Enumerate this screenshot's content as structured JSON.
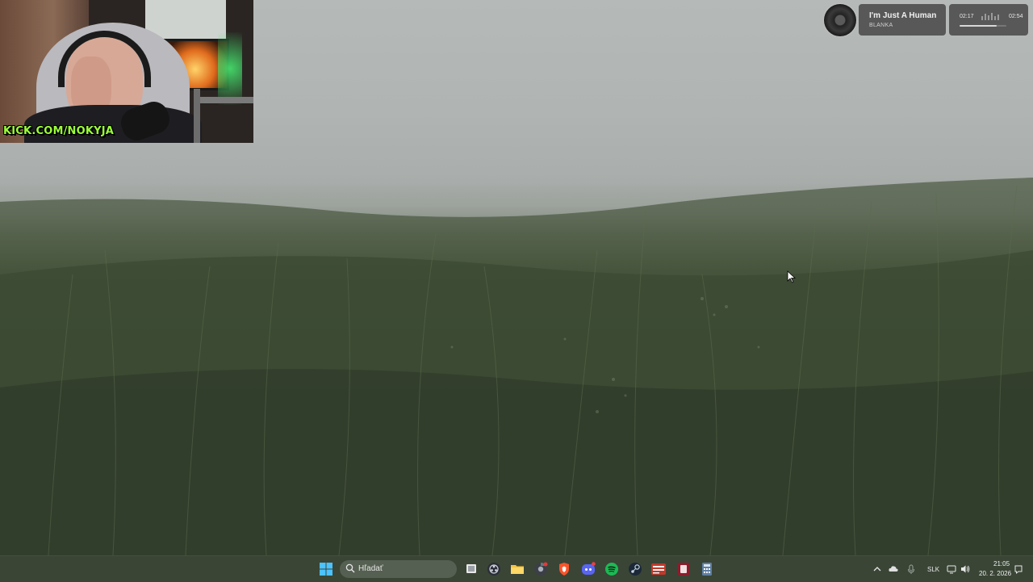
{
  "webcam": {
    "handle_text": "KICK.COM/NOKYJA"
  },
  "media_player": {
    "icon": "vinyl-disc-icon",
    "track_title": "I'm Just A Human",
    "artist": "BLANKA",
    "current_time": "02:17",
    "total_time": "02:54",
    "progress_fraction": 0.79
  },
  "taskbar": {
    "search_placeholder": "Hľadať",
    "pinned_icons": [
      "windows-start-icon",
      "search-icon",
      "task-view-icon",
      "obs-icon",
      "file-explorer-icon",
      "chromium-icon",
      "brave-icon",
      "discord-icon",
      "spotify-icon",
      "steam-icon",
      "voicemeeter-icon",
      "streamlabs-icon",
      "calculator-icon"
    ],
    "tray": {
      "language": "SLK",
      "time": "21:05",
      "date": "20. 2. 2026"
    }
  },
  "colors": {
    "taskbar_bg": "#3a4536",
    "kick_green": "#9cff3a",
    "spotify_green": "#1db954"
  }
}
